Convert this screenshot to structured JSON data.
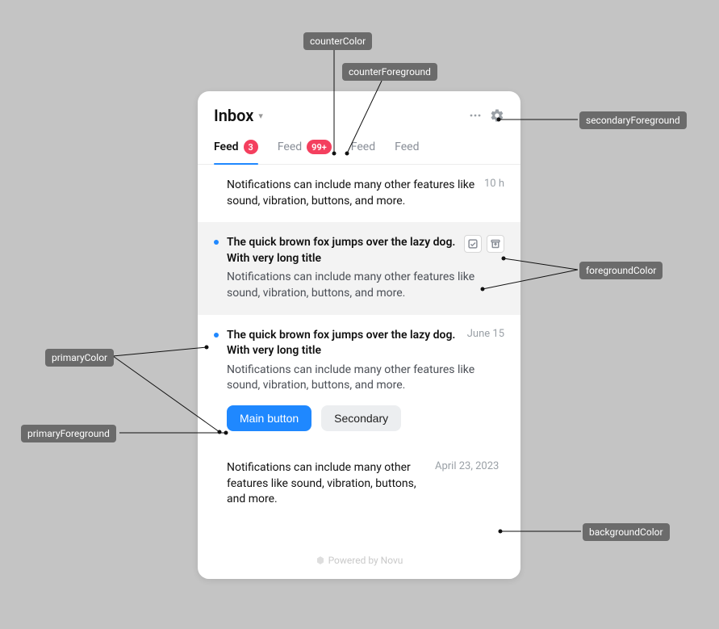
{
  "header": {
    "title": "Inbox"
  },
  "tabs": [
    {
      "label": "Feed",
      "count": "3",
      "active": true
    },
    {
      "label": "Feed",
      "count": "99+",
      "active": false
    },
    {
      "label": "Feed",
      "count": "",
      "active": false
    },
    {
      "label": "Feed",
      "count": "",
      "active": false
    }
  ],
  "items": [
    {
      "title": "",
      "desc": "Notifications can include many other features like sound, vibration, buttons, and more.",
      "time": "10 h"
    },
    {
      "title": "The quick brown fox jumps over the lazy dog. With very long title",
      "desc": "Notifications can include many other features like sound, vibration, buttons, and more.",
      "time": ""
    },
    {
      "title": "The quick brown fox jumps over the lazy dog. With very long title",
      "desc": "Notifications can include many other features like sound, vibration, buttons, and more.",
      "time": "June 15",
      "primary_btn": "Main button",
      "secondary_btn": "Secondary"
    },
    {
      "title": "",
      "desc": "Notifications can include many other features like sound, vibration, buttons, and more.",
      "time": "April 23, 2023"
    }
  ],
  "footer": "Powered by Novu",
  "callouts": {
    "counterColor": "counterColor",
    "counterForeground": "counterForeground",
    "secondaryForeground": "secondaryForeground",
    "foregroundColor": "foregroundColor",
    "primaryColor": "primaryColor",
    "primaryForeground": "primaryForeground",
    "backgroundColor": "backgroundColor"
  },
  "colors": {
    "primaryColor": "#1f88ff",
    "primaryForeground": "#ffffff",
    "counterColor": "#f43f5e",
    "counterForeground": "#ffffff",
    "secondaryForeground": "#9aa0a6",
    "foregroundColor": "#111111",
    "backgroundColor": "#ffffff"
  }
}
